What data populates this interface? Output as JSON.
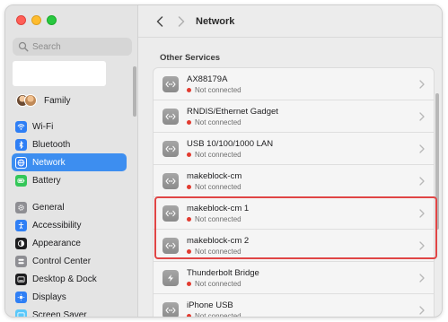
{
  "window": {
    "title": "Network"
  },
  "colors": {
    "accent": "#3d8ef0",
    "status_disconnected": "#e23b30",
    "highlight": "#e04545"
  },
  "sidebar": {
    "search_placeholder": "Search",
    "family_label": "Family",
    "items": [
      {
        "label": "Wi-Fi",
        "icon": "wifi-icon",
        "color": "#2f7ff5"
      },
      {
        "label": "Bluetooth",
        "icon": "bluetooth-icon",
        "color": "#2f7ff5"
      },
      {
        "label": "Network",
        "icon": "globe-icon",
        "color": "#2f7ff5",
        "selected": true
      },
      {
        "label": "Battery",
        "icon": "battery-icon",
        "color": "#34c759"
      },
      {
        "label": "General",
        "icon": "gear-icon",
        "color": "#8e8e93"
      },
      {
        "label": "Accessibility",
        "icon": "accessibility-icon",
        "color": "#2f7ff5"
      },
      {
        "label": "Appearance",
        "icon": "appearance-icon",
        "color": "#1d1d1f"
      },
      {
        "label": "Control Center",
        "icon": "control-center-icon",
        "color": "#8e8e93"
      },
      {
        "label": "Desktop & Dock",
        "icon": "desktop-dock-icon",
        "color": "#1d1d1f"
      },
      {
        "label": "Displays",
        "icon": "displays-icon",
        "color": "#2f7ff5"
      },
      {
        "label": "Screen Saver",
        "icon": "screen-saver-icon",
        "color": "#5ac8fa"
      }
    ]
  },
  "main": {
    "section_title": "Other Services",
    "services": [
      {
        "name": "AX88179A",
        "status": "Not connected",
        "icon": "ethernet-icon"
      },
      {
        "name": "RNDIS/Ethernet Gadget",
        "status": "Not connected",
        "icon": "ethernet-icon"
      },
      {
        "name": "USB 10/100/1000 LAN",
        "status": "Not connected",
        "icon": "ethernet-icon"
      },
      {
        "name": "makeblock-cm",
        "status": "Not connected",
        "icon": "ethernet-icon"
      },
      {
        "name": "makeblock-cm 1",
        "status": "Not connected",
        "icon": "ethernet-icon"
      },
      {
        "name": "makeblock-cm 2",
        "status": "Not connected",
        "icon": "ethernet-icon"
      },
      {
        "name": "Thunderbolt Bridge",
        "status": "Not connected",
        "icon": "thunderbolt-icon"
      },
      {
        "name": "iPhone USB",
        "status": "Not connected",
        "icon": "ethernet-icon"
      }
    ]
  }
}
